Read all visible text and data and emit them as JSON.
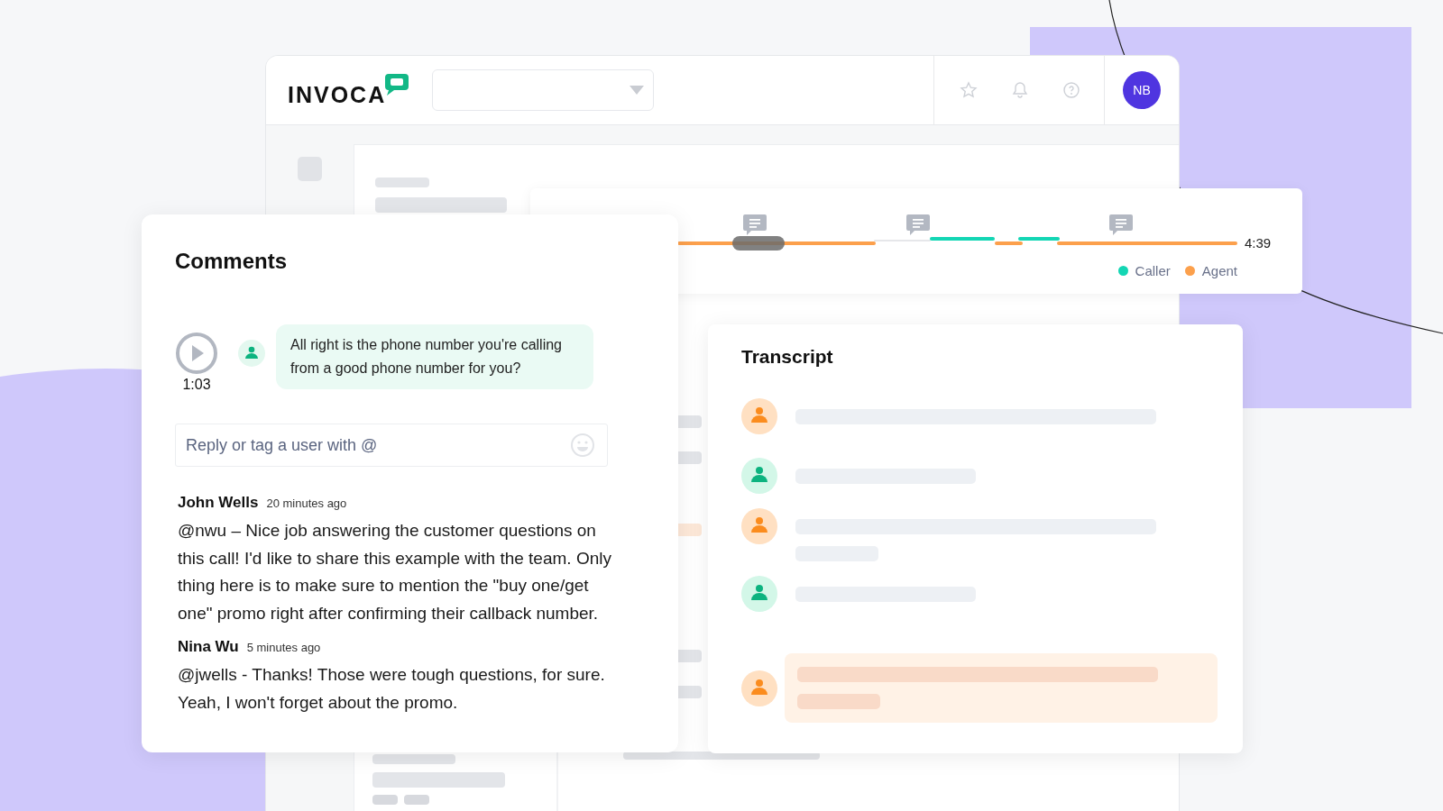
{
  "header": {
    "logo": "INVOCA",
    "avatar_initials": "NB"
  },
  "timeline": {
    "duration": "4:39",
    "legend": [
      {
        "label": "Caller",
        "color": "#13d6b4"
      },
      {
        "label": "Agent",
        "color": "#fca04c"
      }
    ]
  },
  "comments": {
    "title": "Comments",
    "clip": {
      "time": "1:03",
      "quote": "All right is the phone number you're calling from a good phone number for you?"
    },
    "reply": {
      "placeholder": "Reply or tag a user with @"
    },
    "items": [
      {
        "author": "John Wells",
        "time": "20 minutes ago",
        "text": "@nwu – Nice job answering the customer questions on this call! I'd like to share this example with the team. Only thing here is to make sure to mention the \"buy one/get one\" promo right after confirming their callback number."
      },
      {
        "author": "Nina Wu",
        "time": "5 minutes ago",
        "text": "@jwells - Thanks! Those were tough questions, for sure. Yeah, I won't forget about the promo."
      }
    ]
  },
  "transcript": {
    "title": "Transcript",
    "lines": [
      {
        "kind": "agent",
        "highlighted": false
      },
      {
        "kind": "caller",
        "highlighted": false
      },
      {
        "kind": "agent",
        "highlighted": false
      },
      {
        "kind": "caller",
        "highlighted": false
      },
      {
        "kind": "agent",
        "highlighted": true
      }
    ]
  }
}
